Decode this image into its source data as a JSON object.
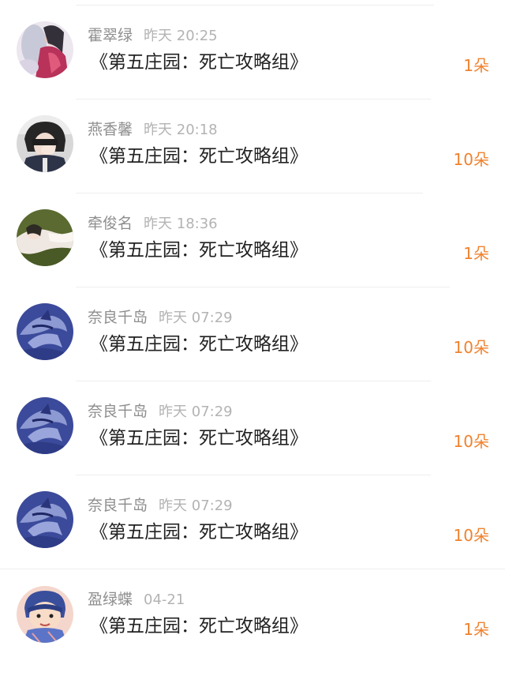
{
  "messages": [
    {
      "name": "霍翠绿",
      "time": "昨天 20:25",
      "title": "《第五庄园：死亡攻略组》",
      "count": "1朵",
      "avatar": "avatar-artwork"
    },
    {
      "name": "燕香馨",
      "time": "昨天 20:18",
      "title": "《第五庄园：死亡攻略组》",
      "count": "10朵",
      "avatar": "avatar-photo"
    },
    {
      "name": "牵俊名",
      "time": "昨天 18:36",
      "title": "《第五庄园：死亡攻略组》",
      "count": "1朵",
      "avatar": "avatar-photo"
    },
    {
      "name": "奈良千岛",
      "time": "昨天 07:29",
      "title": "《第五庄园：死亡攻略组》",
      "count": "10朵",
      "avatar": "avatar-blue-artwork"
    },
    {
      "name": "奈良千岛",
      "time": "昨天 07:29",
      "title": "《第五庄园：死亡攻略组》",
      "count": "10朵",
      "avatar": "avatar-blue-artwork"
    },
    {
      "name": "奈良千岛",
      "time": "昨天 07:29",
      "title": "《第五庄园：死亡攻略组》",
      "count": "10朵",
      "avatar": "avatar-blue-artwork"
    },
    {
      "name": "盈绿蝶",
      "time": "04-21",
      "title": "《第五庄园：死亡攻略组》",
      "count": "1朵",
      "avatar": "avatar-cartoon"
    }
  ],
  "colors": {
    "count": "#f0822e",
    "name": "#8e8e8e",
    "time": "#b3b3b3",
    "title": "#222222",
    "divider": "#eeeeee"
  }
}
